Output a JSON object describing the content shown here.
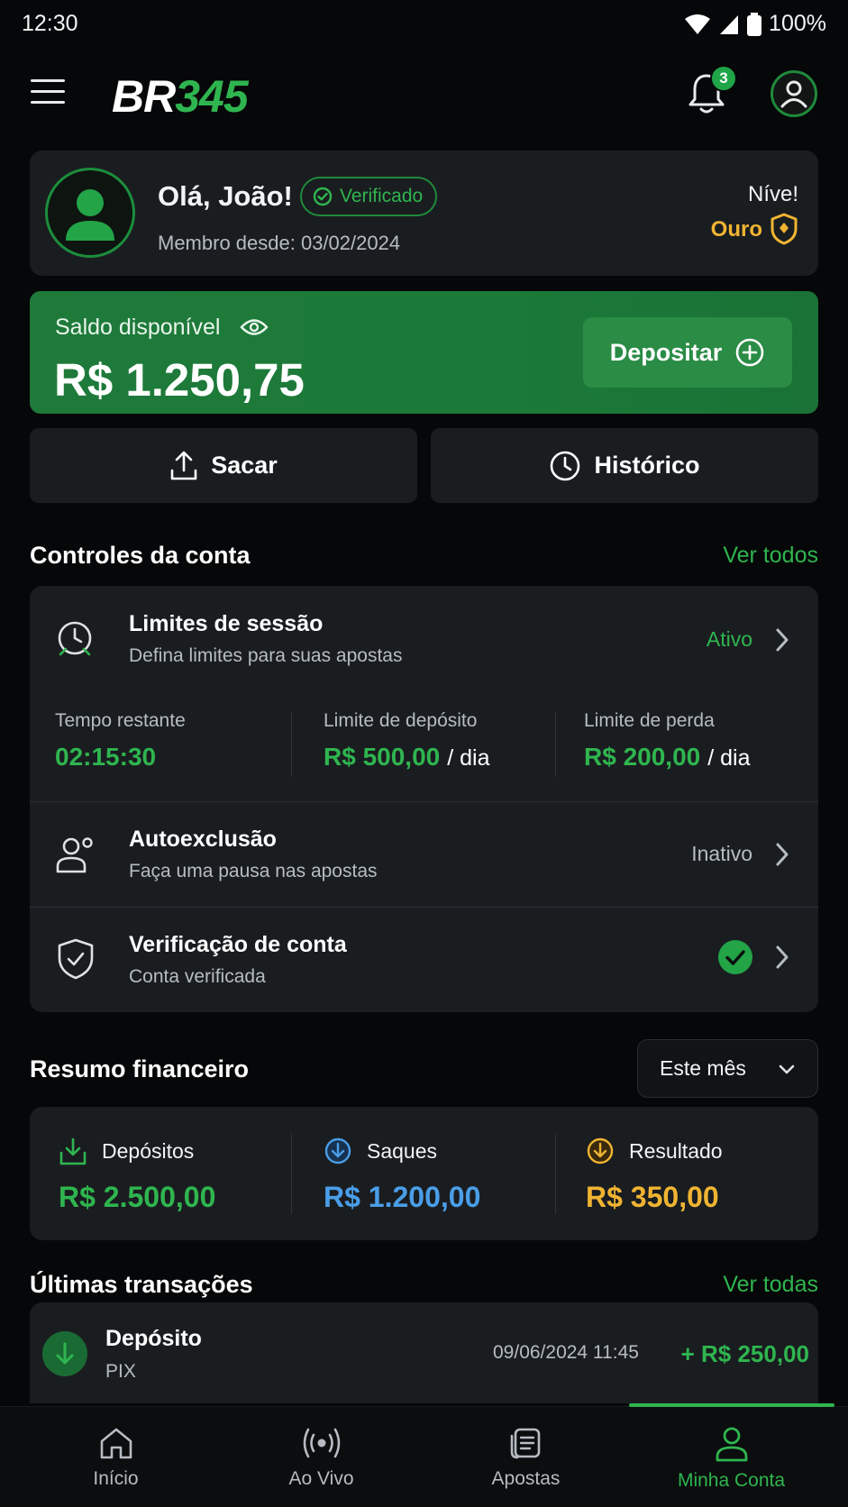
{
  "status_bar": {
    "time": "12:30",
    "battery": "100%"
  },
  "header": {
    "logo_part1": "BR",
    "logo_part2": "345",
    "notification_count": "3"
  },
  "profile": {
    "greeting": "Olá, João!",
    "verified_label": "Verificado",
    "member_since": "Membro desde: 03/02/2024",
    "level_label": "Níve!",
    "level_value": "Ouro"
  },
  "balance": {
    "label": "Saldo disponível",
    "amount": "R$ 1.250,75",
    "deposit_label": "Depositar"
  },
  "actions": {
    "withdraw_label": "Sacar",
    "history_label": "Histórico"
  },
  "account_controls": {
    "title": "Controles da conta",
    "link": "Ver todos",
    "session": {
      "title": "Limites de sessão",
      "subtitle": "Defina limites para suas apostas",
      "status": "Ativo",
      "stats": [
        {
          "label": "Tempo restante",
          "value": "02:15:30",
          "suffix": ""
        },
        {
          "label": "Limite de depósito",
          "value": "R$ 500,00",
          "suffix": "/ dia"
        },
        {
          "label": "Limite de perda",
          "value": "R$ 200,00",
          "suffix": "/ dia"
        }
      ]
    },
    "self_exclusion": {
      "title": "Autoexclusão",
      "subtitle": "Faça uma pausa nas apostas",
      "status": "Inativo"
    },
    "verification": {
      "title": "Verificação de conta",
      "subtitle": "Conta verificada"
    }
  },
  "financial_summary": {
    "title": "Resumo financeiro",
    "period": "Este mês",
    "items": [
      {
        "label": "Depósitos",
        "value": "R$ 2.500,00",
        "color": "#2fb54f"
      },
      {
        "label": "Saques",
        "value": "R$ 1.200,00",
        "color": "#4a9ee8"
      },
      {
        "label": "Resultado",
        "value": "R$ 350,00",
        "color": "#f0b432"
      }
    ]
  },
  "transactions": {
    "title": "Últimas transações",
    "link": "Ver todas",
    "items": [
      {
        "type": "Depósito",
        "method": "PIX",
        "datetime": "09/06/2024 11:45",
        "amount": "+ R$ 250,00"
      }
    ]
  },
  "bottom_nav": [
    {
      "label": "Início",
      "icon": "home-icon"
    },
    {
      "label": "Ao Vivo",
      "icon": "live-icon"
    },
    {
      "label": "Apostas",
      "icon": "bets-icon"
    },
    {
      "label": "Minha Conta",
      "icon": "account-icon",
      "active": true
    }
  ],
  "colors": {
    "accent": "#2fb54f",
    "gold": "#f0b432",
    "blue": "#4a9ee8",
    "background": "#060708",
    "card": "#1a1d20"
  }
}
